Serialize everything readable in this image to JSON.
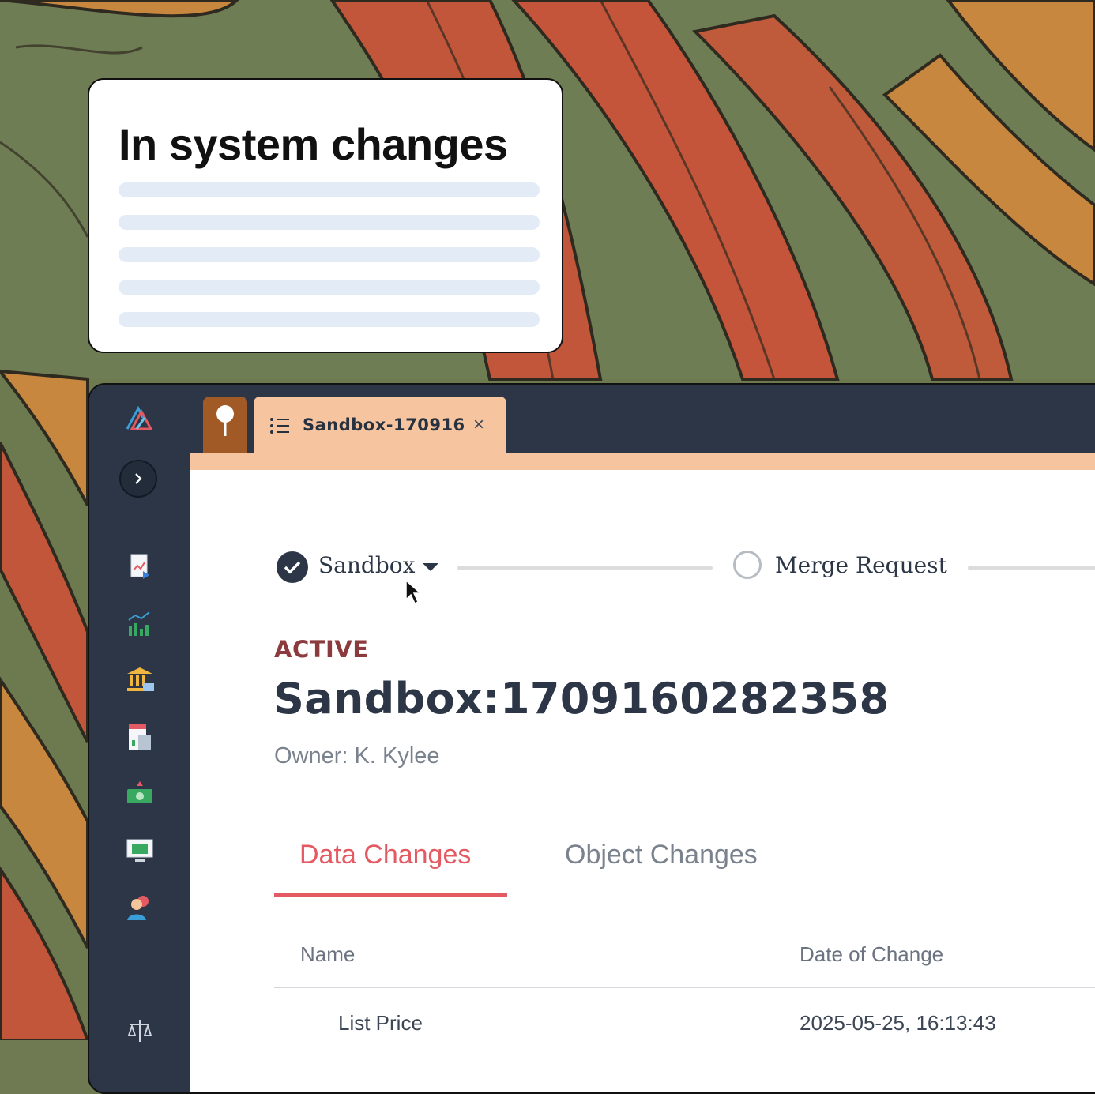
{
  "callout": {
    "title": "In system changes"
  },
  "sidebar": {
    "expand_icon": "chevron-right-icon",
    "icons": [
      "report-icon",
      "chart-icon",
      "bank-icon",
      "calculator-icon",
      "money-icon",
      "monitor-icon",
      "users-icon",
      "scale-icon"
    ]
  },
  "tabs": {
    "document_tab_label": "Sandbox-170916",
    "close_glyph": "×"
  },
  "stepper": {
    "step1_label": "Sandbox",
    "step2_label": "Merge Request"
  },
  "record": {
    "status": "ACTIVE",
    "title": "Sandbox:1709160282358",
    "owner": "Owner: K. Kylee"
  },
  "content_tabs": {
    "active": "Data Changes",
    "inactive": "Object Changes"
  },
  "table": {
    "headers": [
      "Name",
      "Date of Change"
    ],
    "rows": [
      [
        "List Price",
        "2025-05-25, 16:13:43"
      ]
    ]
  },
  "colors": {
    "sidebar_bg": "#2c3646",
    "tab_accent": "#f6c59f",
    "pin_tab": "#a15a25",
    "status": "#8b3b3e",
    "active_tab": "#e35a62"
  }
}
